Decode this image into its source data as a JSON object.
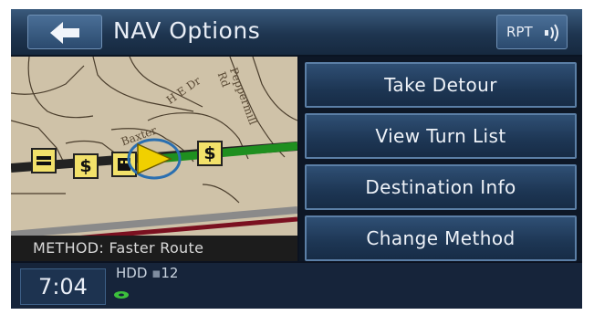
{
  "header": {
    "title": "NAV Options",
    "rpt_label": "RPT"
  },
  "map": {
    "method_label": "METHOD:",
    "method_value": "Faster Route",
    "road_labels": [
      "Peppermill Rd",
      "Baxter",
      "H E Dr"
    ],
    "poi_icons": [
      "hotel-icon",
      "dollar-icon",
      "dollar-icon",
      "building-icon",
      "dollar-icon"
    ],
    "poi_text": [
      "$",
      "$",
      "$"
    ],
    "route_color": "#1f8f1f",
    "vehicle_color": "#f0d000"
  },
  "menu": {
    "items": [
      {
        "label": "Take Detour"
      },
      {
        "label": "View Turn List"
      },
      {
        "label": "Destination Info"
      },
      {
        "label": "Change Method"
      }
    ]
  },
  "footer": {
    "time": "7:04",
    "hdd_label": "HDD",
    "hdd_value": "12"
  },
  "colors": {
    "accent": "#5b7fa6",
    "background": "#0b1220",
    "header": "#2b4a6e"
  }
}
